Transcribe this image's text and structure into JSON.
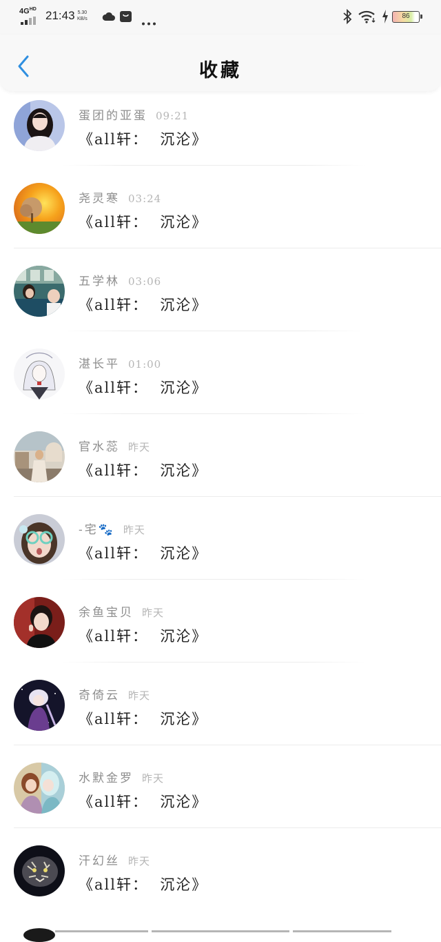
{
  "status_bar": {
    "network": "4G",
    "network_sup": "HD",
    "time": "21:43",
    "speed_value": "5.30",
    "speed_unit": "KB/s",
    "battery": "86"
  },
  "header": {
    "title": "收藏"
  },
  "items": [
    {
      "name": "蛋团的亚蛋",
      "time": "09:21",
      "message": "《all轩：  沉沦》",
      "avatar": "avatar-girl-dark-hair"
    },
    {
      "name": "尧灵寒",
      "time": "03:24",
      "message": "《all轩：  沉沦》",
      "avatar": "avatar-sunset-tree"
    },
    {
      "name": "五学林",
      "time": "03:06",
      "message": "《all轩：  沉沦》",
      "avatar": "avatar-couple-train"
    },
    {
      "name": "湛长平",
      "time": "01:00",
      "message": "《all轩：  沉沦》",
      "avatar": "avatar-anime-white-hair"
    },
    {
      "name": "官水蕊",
      "time": "昨天",
      "message": "《all轩：  沉沦》",
      "avatar": "avatar-city-girl"
    },
    {
      "name": "-宅🐾",
      "time": "昨天",
      "message": "《all轩：  沉沦》",
      "avatar": "avatar-girl-glasses"
    },
    {
      "name": "余鱼宝贝",
      "time": "昨天",
      "message": "《all轩：  沉沦》",
      "avatar": "avatar-boy-portrait"
    },
    {
      "name": "奇倚云",
      "time": "昨天",
      "message": "《all轩：  沉沦》",
      "avatar": "avatar-anime-purple"
    },
    {
      "name": "水默金罗",
      "time": "昨天",
      "message": "《all轩：  沉沦》",
      "avatar": "avatar-anime-couple"
    },
    {
      "name": "汗幻丝",
      "time": "昨天",
      "message": "《all轩：  沉沦》",
      "avatar": "avatar-tiger-dark"
    }
  ],
  "colors": {
    "accent": "#2f8fe0",
    "name_gray": "#8e8e8e",
    "time_gray": "#b5b5b5"
  }
}
